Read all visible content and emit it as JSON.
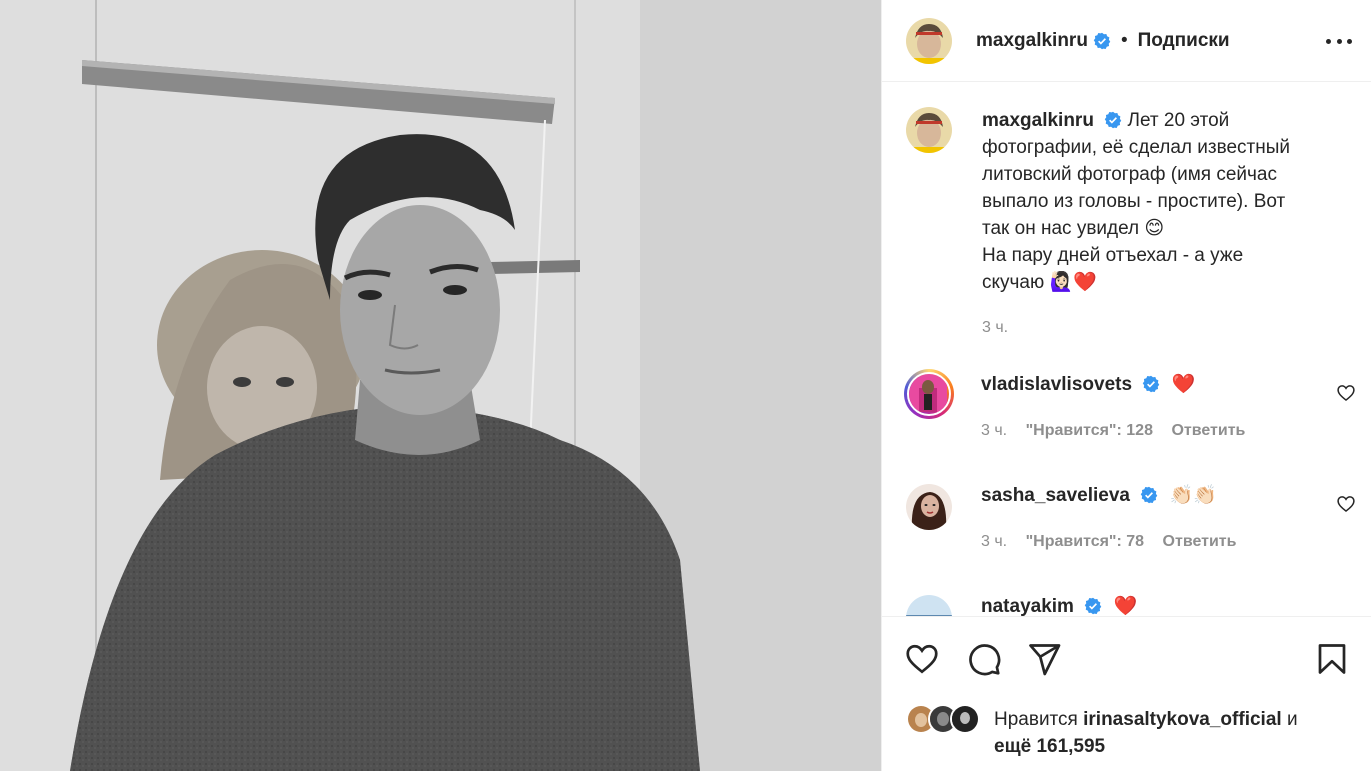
{
  "post": {
    "author": "maxgalkinru",
    "separator": "•",
    "follow_label": "Подписки",
    "caption_lines": [
      "Лет 20 этой",
      "фотографии, её сделал известный",
      "литовский фотограф (имя сейчас",
      "выпало из головы - простите). Вот",
      "так он нас увидел 😊",
      "На пару дней отъехал - а уже",
      "скучаю 🙋🏻‍♀️❤️"
    ],
    "caption_time": "3 ч."
  },
  "comments": [
    {
      "user": "vladislavlisovets",
      "text": "❤️",
      "time": "3 ч.",
      "likes": "\"Нравится\": 128",
      "reply": "Ответить",
      "story": true
    },
    {
      "user": "sasha_savelieva",
      "text": "👏🏻👏🏻",
      "time": "3 ч.",
      "likes": "\"Нравится\": 78",
      "reply": "Ответить",
      "story": false
    },
    {
      "user": "natayakim",
      "text": "❤️",
      "time": "",
      "likes": "",
      "reply": "",
      "story": false
    }
  ],
  "likes": {
    "prefix": "Нравится",
    "user": "irinasaltykova_official",
    "conj": "и",
    "rest": "ещё 161,595"
  },
  "icons": {
    "verified": "verified-badge-icon",
    "like": "heart-icon",
    "comment": "comment-icon",
    "share": "paper-plane-icon",
    "save": "bookmark-icon",
    "more": "more-options-icon"
  },
  "colors": {
    "verified": "#3897f0",
    "text": "#262626",
    "muted": "#8e8e8e",
    "divider": "#efefef",
    "heart": "#ed4956"
  }
}
